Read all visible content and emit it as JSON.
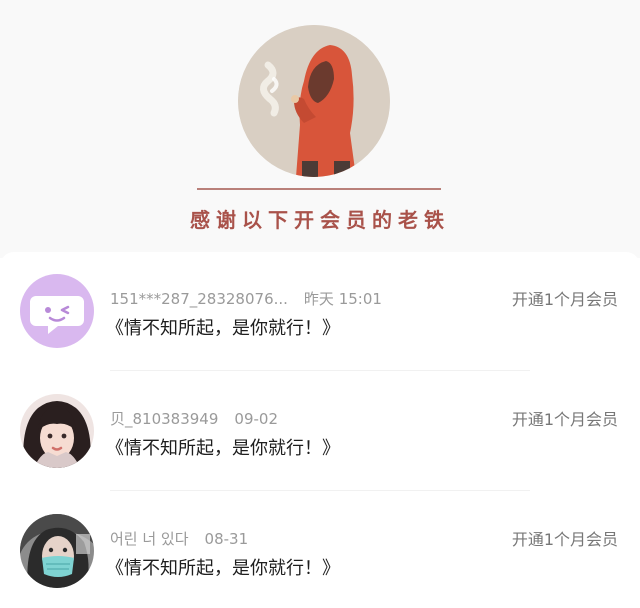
{
  "banner": {
    "title": "感谢以下开会员的老铁",
    "hero_image": "red-hooded-figure-smoking-illustration"
  },
  "members": [
    {
      "username": "151***287_28328076...",
      "time": "昨天 15:01",
      "message": "《情不知所起，是你就行！》",
      "action": "开通1个月会员",
      "avatar": "purple-chat-bubble-winking-face"
    },
    {
      "username": "贝_810383949",
      "time": "09-02",
      "message": "《情不知所起，是你就行！》",
      "action": "开通1个月会员",
      "avatar": "girl-with-bangs-photo"
    },
    {
      "username": "어린 너 있다",
      "time": "08-31",
      "message": "《情不知所起，是你就行！》",
      "action": "开通1个月会员",
      "avatar": "girl-with-teal-mask-photo"
    }
  ],
  "colors": {
    "banner_bg": "#f9f9f9",
    "banner_title": "#a9524a",
    "hoodie_red": "#d8553a",
    "meta_gray": "#9a9a9a",
    "message_text": "#1e1e1e",
    "action_text": "#777777",
    "purple_avatar": "#d9b8ef"
  }
}
